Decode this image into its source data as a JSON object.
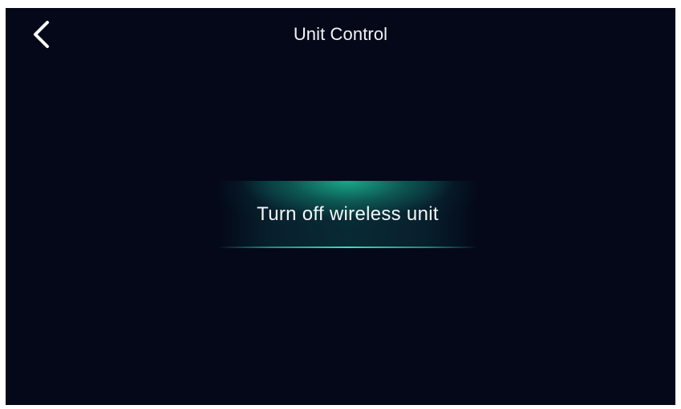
{
  "header": {
    "title": "Unit Control",
    "back_icon": "chevron-left-icon"
  },
  "main": {
    "action_button_label": "Turn off wireless unit"
  },
  "colors": {
    "background": "#040818",
    "accent": "#1cc89e",
    "text": "#f2f4f8"
  }
}
